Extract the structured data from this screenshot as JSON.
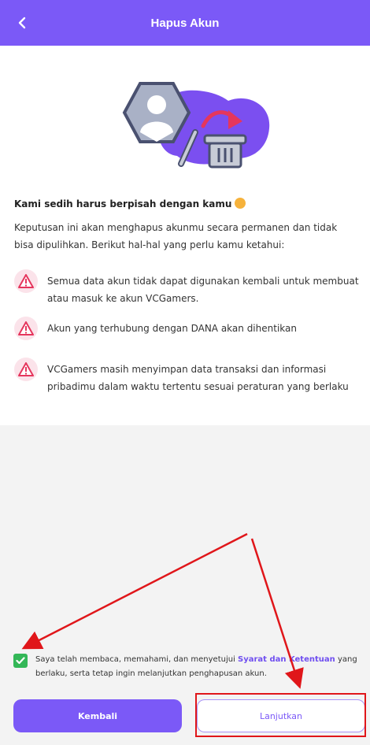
{
  "header": {
    "title": "Hapus Akun"
  },
  "intro": {
    "heading": "Kami sedih harus berpisah dengan kamu",
    "description": "Keputusan ini akan menghapus akunmu secara permanen dan tidak bisa dipulihkan. Berikut hal-hal yang perlu kamu ketahui:"
  },
  "notices": [
    "Semua data akun tidak dapat digunakan kembali untuk membuat atau masuk ke akun VCGamers.",
    "Akun yang terhubung dengan DANA akan dihentikan",
    "VCGamers masih menyimpan data transaksi dan informasi pribadimu dalam waktu tertentu sesuai peraturan yang berlaku"
  ],
  "agreement": {
    "checked": true,
    "before": "Saya telah membaca, memahami, dan menyetujui ",
    "link": "Syarat dan Ketentuan",
    "after": " yang berlaku, serta tetap ingin melanjutkan penghapusan akun."
  },
  "buttons": {
    "back": "Kembali",
    "next": "Lanjutkan"
  },
  "colors": {
    "primary": "#7b59f7",
    "check": "#33b757",
    "warning": "#e5365d",
    "annotation": "#e0161a"
  }
}
